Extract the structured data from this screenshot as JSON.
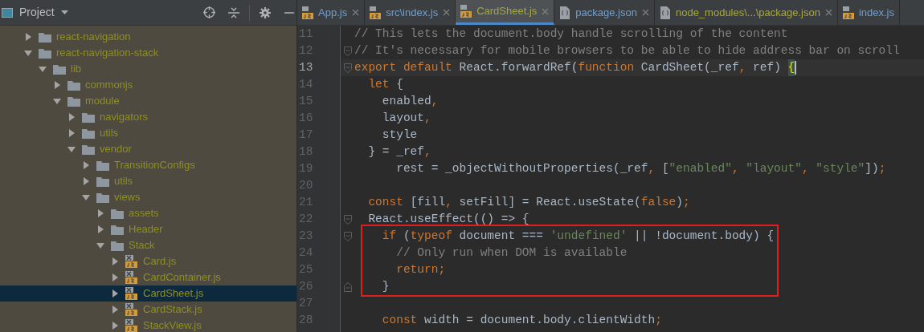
{
  "project_panel": {
    "title": "Project",
    "tree": [
      {
        "label": "react-navigation",
        "kind": "folder",
        "expanded": false,
        "selected": false
      },
      {
        "label": "react-navigation-stack",
        "kind": "folder",
        "expanded": true,
        "selected": false,
        "children": [
          {
            "label": "lib",
            "kind": "folder",
            "expanded": true,
            "selected": false,
            "children": [
              {
                "label": "commonjs",
                "kind": "folder",
                "expanded": false,
                "selected": false
              },
              {
                "label": "module",
                "kind": "folder",
                "expanded": true,
                "selected": false,
                "children": [
                  {
                    "label": "navigators",
                    "kind": "folder",
                    "expanded": false,
                    "selected": false
                  },
                  {
                    "label": "utils",
                    "kind": "folder",
                    "expanded": false,
                    "selected": false
                  },
                  {
                    "label": "vendor",
                    "kind": "folder",
                    "expanded": true,
                    "selected": false,
                    "children": [
                      {
                        "label": "TransitionConfigs",
                        "kind": "folder",
                        "expanded": false,
                        "selected": false
                      },
                      {
                        "label": "utils",
                        "kind": "folder",
                        "expanded": false,
                        "selected": false
                      },
                      {
                        "label": "views",
                        "kind": "folder",
                        "expanded": true,
                        "selected": false,
                        "children": [
                          {
                            "label": "assets",
                            "kind": "folder",
                            "expanded": false,
                            "selected": false
                          },
                          {
                            "label": "Header",
                            "kind": "folder",
                            "expanded": false,
                            "selected": false
                          },
                          {
                            "label": "Stack",
                            "kind": "folder",
                            "expanded": true,
                            "selected": false,
                            "children": [
                              {
                                "label": "Card.js",
                                "kind": "js",
                                "expanded": false,
                                "selected": false
                              },
                              {
                                "label": "CardContainer.js",
                                "kind": "js",
                                "expanded": false,
                                "selected": false
                              },
                              {
                                "label": "CardSheet.js",
                                "kind": "js",
                                "expanded": false,
                                "selected": true
                              },
                              {
                                "label": "CardStack.js",
                                "kind": "js",
                                "expanded": false,
                                "selected": false
                              },
                              {
                                "label": "StackView.js",
                                "kind": "js",
                                "expanded": false,
                                "selected": false
                              }
                            ]
                          }
                        ]
                      }
                    ]
                  }
                ]
              }
            ]
          }
        ]
      }
    ]
  },
  "tabs": [
    {
      "label": "App.js",
      "kind": "js",
      "selected": false,
      "closable": true,
      "color": "#6f9fd0"
    },
    {
      "label": "src\\index.js",
      "kind": "js",
      "selected": false,
      "closable": true,
      "color": "#6f9fd0"
    },
    {
      "label": "CardSheet.js",
      "kind": "js",
      "selected": true,
      "closable": true,
      "color": "#a8a83a"
    },
    {
      "label": "package.json",
      "kind": "json",
      "selected": false,
      "closable": true,
      "color": "#6f9fd0"
    },
    {
      "label": "node_modules\\...\\package.json",
      "kind": "json",
      "selected": false,
      "closable": true,
      "color": "#a8a83a"
    },
    {
      "label": "index.js",
      "kind": "js",
      "selected": false,
      "closable": false,
      "color": "#6f9fd0"
    }
  ],
  "code": [
    {
      "number": "11",
      "current": false,
      "tokens": [
        {
          "kind": "comment",
          "text": "// This lets the document.body handle scrolling of the content"
        }
      ]
    },
    {
      "number": "12",
      "current": false,
      "fold_start": true,
      "tokens": [
        {
          "kind": "comment",
          "text": "// It's necessary for mobile browsers to be able to hide address bar on scroll"
        }
      ]
    },
    {
      "number": "13",
      "current": true,
      "fold_start": true,
      "tokens": [
        {
          "kind": "keyword",
          "text": "export default "
        },
        {
          "kind": "plain",
          "text": "React.forwardRef("
        },
        {
          "kind": "keyword",
          "text": "function "
        },
        {
          "kind": "plain",
          "text": "CardSheet(_ref"
        },
        {
          "kind": "keyword",
          "text": ", "
        },
        {
          "kind": "plain",
          "text": "ref) "
        },
        {
          "kind": "brace_match",
          "text": "{"
        }
      ]
    },
    {
      "number": "14",
      "current": false,
      "tokens": [
        {
          "kind": "keyword",
          "text": "  let "
        },
        {
          "kind": "plain",
          "text": "{"
        }
      ]
    },
    {
      "number": "15",
      "current": false,
      "tokens": [
        {
          "kind": "plain",
          "text": "    enabled"
        },
        {
          "kind": "keyword",
          "text": ","
        }
      ]
    },
    {
      "number": "16",
      "current": false,
      "tokens": [
        {
          "kind": "plain",
          "text": "    layout"
        },
        {
          "kind": "keyword",
          "text": ","
        }
      ]
    },
    {
      "number": "17",
      "current": false,
      "tokens": [
        {
          "kind": "plain",
          "text": "    style"
        }
      ]
    },
    {
      "number": "18",
      "current": false,
      "tokens": [
        {
          "kind": "plain",
          "text": "  } = _ref"
        },
        {
          "kind": "keyword",
          "text": ","
        }
      ]
    },
    {
      "number": "19",
      "current": false,
      "tokens": [
        {
          "kind": "plain",
          "text": "      rest = _objectWithoutProperties(_ref"
        },
        {
          "kind": "keyword",
          "text": ", "
        },
        {
          "kind": "plain",
          "text": "["
        },
        {
          "kind": "string",
          "text": "\"enabled\""
        },
        {
          "kind": "keyword",
          "text": ", "
        },
        {
          "kind": "string",
          "text": "\"layout\""
        },
        {
          "kind": "keyword",
          "text": ", "
        },
        {
          "kind": "string",
          "text": "\"style\""
        },
        {
          "kind": "plain",
          "text": "])"
        },
        {
          "kind": "keyword",
          "text": ";"
        }
      ]
    },
    {
      "number": "20",
      "current": false
    },
    {
      "number": "21",
      "current": false,
      "tokens": [
        {
          "kind": "keyword",
          "text": "  const "
        },
        {
          "kind": "plain",
          "text": "[fill"
        },
        {
          "kind": "keyword",
          "text": ", "
        },
        {
          "kind": "plain",
          "text": "setFill] = React.useState("
        },
        {
          "kind": "keyword",
          "text": "false"
        },
        {
          "kind": "plain",
          "text": ")"
        },
        {
          "kind": "keyword",
          "text": ";"
        }
      ]
    },
    {
      "number": "22",
      "current": false,
      "fold_start": true,
      "tokens": [
        {
          "kind": "plain",
          "text": "  React.useEffect(() => {"
        }
      ]
    },
    {
      "number": "23",
      "current": false,
      "boxed": true,
      "fold_start": true,
      "tokens": [
        {
          "kind": "keyword",
          "text": "    if "
        },
        {
          "kind": "plain",
          "text": "("
        },
        {
          "kind": "keyword",
          "text": "typeof "
        },
        {
          "kind": "plain",
          "text": "document === "
        },
        {
          "kind": "string",
          "text": "'undefined' "
        },
        {
          "kind": "plain",
          "text": "|| !document.body) {"
        }
      ]
    },
    {
      "number": "24",
      "current": false,
      "boxed": true,
      "tokens": [
        {
          "kind": "comment",
          "text": "      // Only run when DOM is available"
        }
      ]
    },
    {
      "number": "25",
      "current": false,
      "boxed": true,
      "tokens": [
        {
          "kind": "keyword",
          "text": "      return;"
        }
      ]
    },
    {
      "number": "26",
      "current": false,
      "boxed": true,
      "fold_end": true,
      "tokens": [
        {
          "kind": "plain",
          "text": "    }"
        }
      ]
    },
    {
      "number": "27",
      "current": false
    },
    {
      "number": "28",
      "current": false,
      "tokens": [
        {
          "kind": "keyword",
          "text": "    const "
        },
        {
          "kind": "plain",
          "text": "width = document.body.clientWidth"
        },
        {
          "kind": "keyword",
          "text": ";"
        }
      ]
    }
  ]
}
